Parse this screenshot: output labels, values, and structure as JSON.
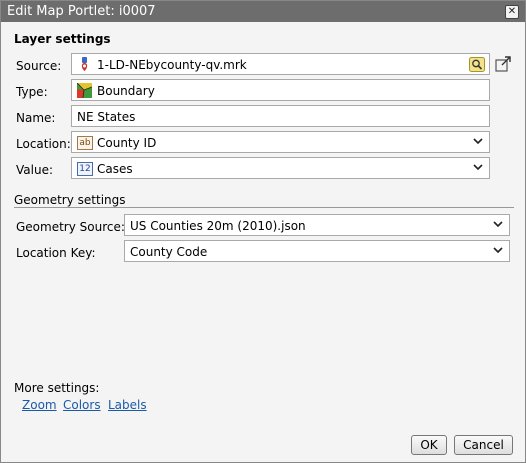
{
  "dialog": {
    "title": "Edit Map Portlet: i0007",
    "close_icon": "close-icon"
  },
  "layer": {
    "heading": "Layer settings",
    "source": {
      "label": "Source:",
      "value": "1-LD-NEbycounty-qv.mrk"
    },
    "type": {
      "label": "Type:",
      "value": "Boundary"
    },
    "name": {
      "label": "Name:",
      "value": "NE States"
    },
    "location": {
      "label": "Location:",
      "value": "County ID",
      "badge": "ab"
    },
    "value": {
      "label": "Value:",
      "value": "Cases",
      "badge": "12"
    }
  },
  "geometry": {
    "heading": "Geometry settings",
    "source": {
      "label": "Geometry Source:",
      "value": "US Counties 20m (2010).json"
    },
    "key": {
      "label": "Location Key:",
      "value": "County Code"
    }
  },
  "more": {
    "label": "More settings:",
    "links": [
      "Zoom",
      "Colors",
      "Labels"
    ]
  },
  "buttons": {
    "ok": "OK",
    "cancel": "Cancel"
  },
  "colors": {
    "titlebar": "#6d6d6d",
    "link": "#1a5aa8"
  }
}
